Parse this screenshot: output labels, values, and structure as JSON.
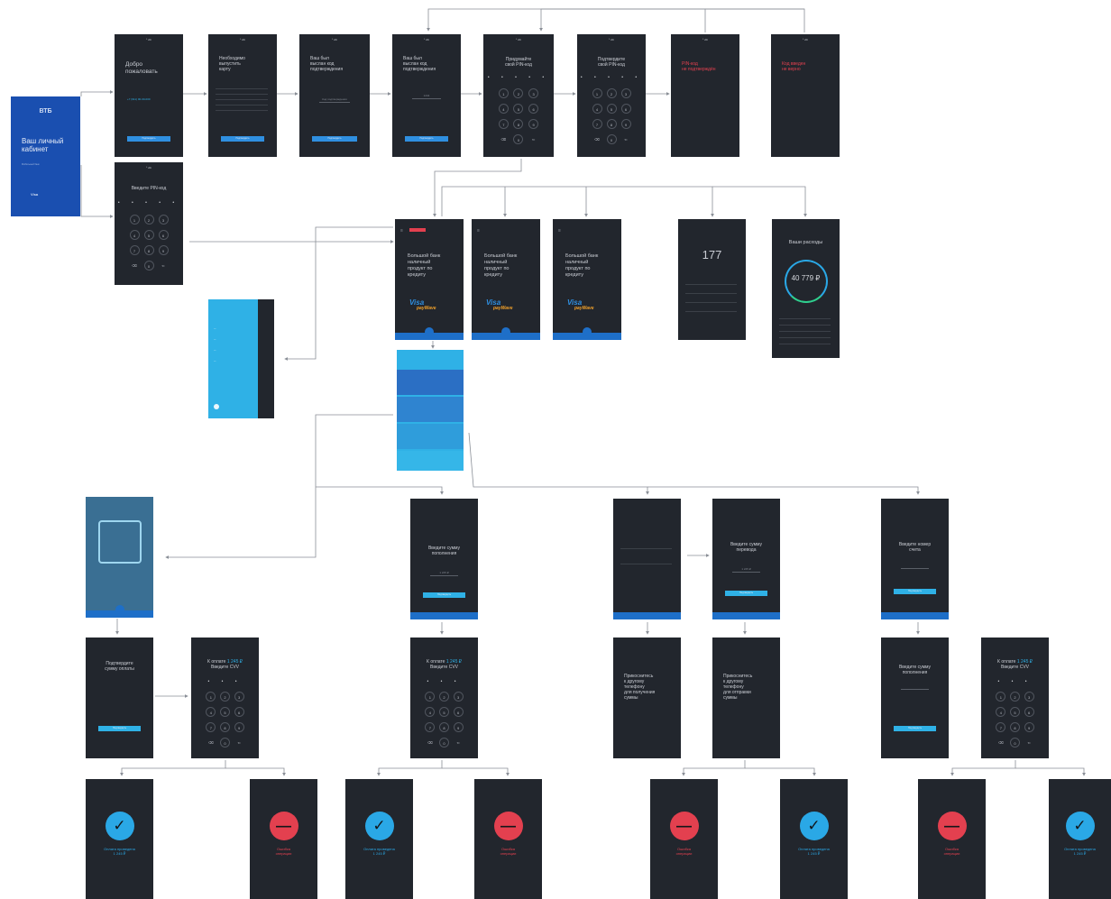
{
  "common": {
    "status": "⁰ vtb",
    "confirm_btn": "Подтвердить",
    "keypad_keys": [
      "1",
      "2",
      "3",
      "4",
      "5",
      "6",
      "7",
      "8",
      "9",
      "⌫",
      "0",
      "⇐"
    ]
  },
  "colors": {
    "screen_bg": "#22262d",
    "brand_blue": "#1a4fb0",
    "accent_cyan": "#2fb1e6",
    "error_red": "#e3404f",
    "success_blue": "#2aa8e6"
  },
  "splash": {
    "logo": "ВТБ",
    "title": "Ваш личный\nкабинет",
    "subtitle": "Мобильный банк",
    "visa_mark": "Visa"
  },
  "welcome": {
    "title": "Добро\nпожаловать",
    "phone": "+7 (911) 00-00-000"
  },
  "accept_card": {
    "title": "Необходимо\nвыпустить\nкарту"
  },
  "enter_code_1": {
    "title": "Ваш был\nвыслан код\nподтверждения",
    "field": "Код подтверждения"
  },
  "enter_code_2": {
    "title": "Ваш был\nвыслан код\nподтверждения",
    "field": "1234"
  },
  "create_pin": {
    "title": "Придумайте\nсвой PIN-код",
    "dots": "• • • • •"
  },
  "confirm_pin": {
    "title": "Подтвердите\nсвой PIN-код",
    "dots": "• • • • •"
  },
  "pin_mismatch": {
    "title": "PIN-код\nне подтверждён"
  },
  "pin_locked": {
    "title": "Код введен\nне верно"
  },
  "enter_pin": {
    "title": "Введите PIN-код",
    "dots": "• • • • •"
  },
  "promo": {
    "title": "Большой банк\nналичный\nпродукт по\nкредиту",
    "visa": "Visa",
    "paywave": "payWave"
  },
  "bonuses": {
    "value": "177"
  },
  "expenses": {
    "title": "Ваши расходы",
    "amount": "40 779 ₽"
  },
  "menu": {},
  "payment_options": {},
  "cvv_screen": {
    "title_prefix": "К оплате ",
    "amount": "1 245 ₽",
    "title_suffix": "\nВведите CVV",
    "dots": "• • •"
  },
  "confirm_payment": {
    "title": "Подтвердите\nсумму оплаты"
  },
  "enter_amount": {
    "title": "Введите сумму\nпополнения",
    "field": "1 245 ₽"
  },
  "enter_amount_2": {
    "title": "Введите сумму\nперевода",
    "field": "1 245 ₽"
  },
  "enter_account": {
    "title": "Введите номер\nсчета"
  },
  "enter_topup": {
    "title": "Введите сумму\nпополнения"
  },
  "nfc_hint": {
    "title": "Прикоснитесь\nк другому\nтелефону\nдля получения\nсуммы"
  },
  "nfc_hint_2": {
    "title": "Прикоснитесь\nк другому\nтелефону\nдля отправки\nсуммы"
  },
  "result_ok": {
    "title": "Оплата проведена\n1 245 ₽",
    "icon": "✓"
  },
  "result_err": {
    "title": "Ошибка\nоперации",
    "icon": "—"
  }
}
